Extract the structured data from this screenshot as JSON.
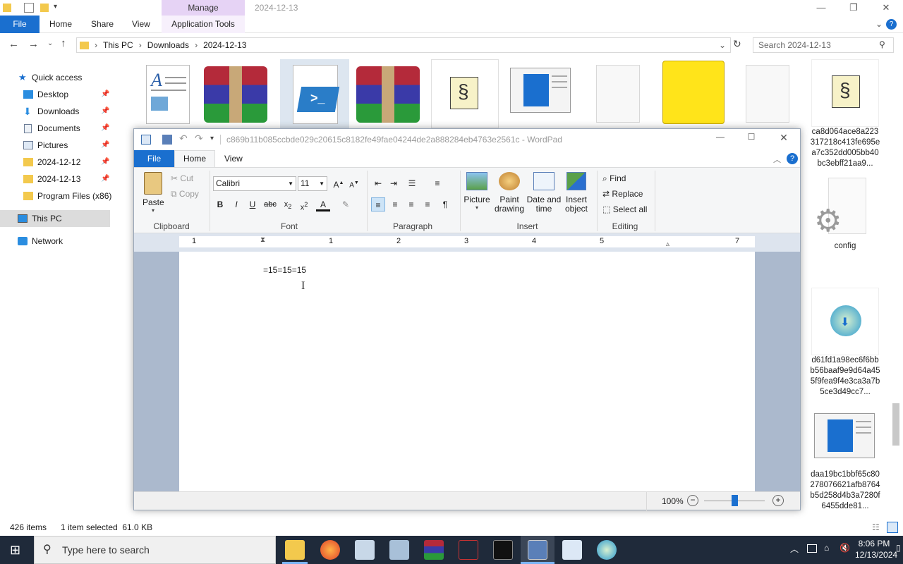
{
  "explorer": {
    "manage_tab": "Manage",
    "window_title": "2024-12-13",
    "tabs": {
      "file": "File",
      "home": "Home",
      "share": "Share",
      "view": "View",
      "application_tools": "Application Tools"
    },
    "address": {
      "this_pc": "This PC",
      "downloads": "Downloads",
      "folder": "2024-12-13"
    },
    "search_placeholder": "Search 2024-12-13",
    "nav": {
      "quick_access": "Quick access",
      "desktop": "Desktop",
      "downloads": "Downloads",
      "documents": "Documents",
      "pictures": "Pictures",
      "folder1": "2024-12-12",
      "folder2": "2024-12-13",
      "program_files": "Program Files (x86)",
      "this_pc": "This PC",
      "network": "Network"
    },
    "files": {
      "f1": "ca8d064ace8a223317218c413fe695ea7c352dd005bb40bc3ebff21aa9...",
      "f2": "config",
      "f3": "d61fd1a98ec6f6bbb56baaf9e9d64a455f9fea9f4e3ca3a7b5ce3d49cc7...",
      "f4": "daa19bc1bbf65c80278076621afb8764b5d258d4b3a7280f6455dde81..."
    },
    "status": {
      "items": "426 items",
      "selected": "1 item selected  61.0 KB"
    }
  },
  "wordpad": {
    "title": "c869b11b085ccbde029c20615c8182fe49fae04244de2a888284eb4763e2561c - WordPad",
    "tabs": {
      "file": "File",
      "home": "Home",
      "view": "View"
    },
    "clipboard": {
      "paste": "Paste",
      "cut": "Cut",
      "copy": "Copy",
      "label": "Clipboard"
    },
    "font": {
      "family": "Calibri",
      "size": "11",
      "label": "Font"
    },
    "paragraph": {
      "label": "Paragraph"
    },
    "insert": {
      "picture": "Picture",
      "paint": "Paint drawing",
      "datetime": "Date and time",
      "object": "Insert object",
      "label": "Insert"
    },
    "editing": {
      "find": "Find",
      "replace": "Replace",
      "select_all": "Select all",
      "label": "Editing"
    },
    "ruler_numbers": [
      "1",
      "1",
      "2",
      "3",
      "4",
      "5",
      "7"
    ],
    "document_text": "=15=15=15",
    "zoom": "100%"
  },
  "taskbar": {
    "search_placeholder": "Type here to search",
    "time": "8:06 PM",
    "date": "12/13/2024"
  },
  "colors": {
    "accent": "#1a6fcf",
    "manage": "#e6d3f5",
    "taskbar": "#1f2a3a"
  }
}
